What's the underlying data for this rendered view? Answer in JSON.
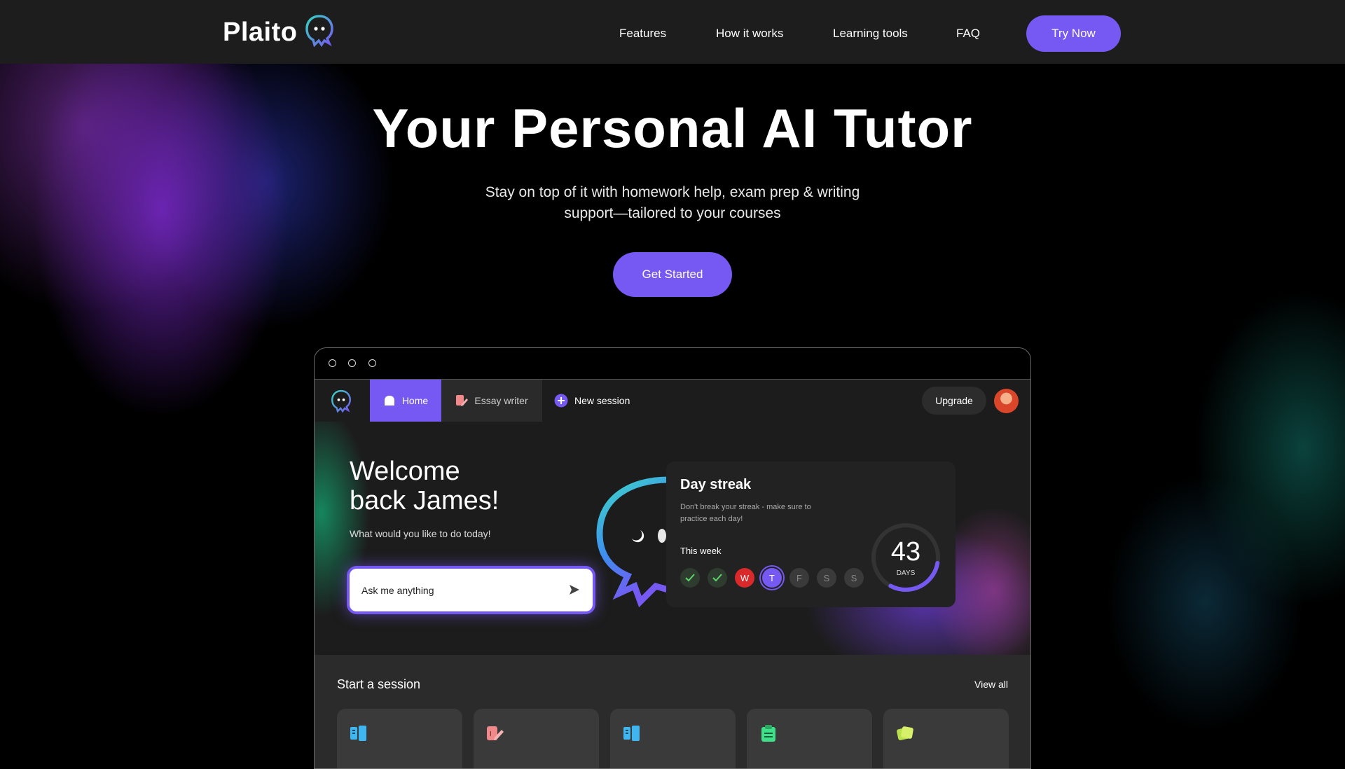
{
  "brand": {
    "name": "Plaito"
  },
  "nav": {
    "links": [
      "Features",
      "How it works",
      "Learning tools",
      "FAQ"
    ],
    "cta": "Try Now"
  },
  "hero": {
    "title": "Your Personal AI Tutor",
    "subtitle_line1": "Stay on top of it with homework help, exam prep & writing",
    "subtitle_line2": "support—tailored to your courses",
    "cta": "Get Started"
  },
  "app": {
    "tabs": {
      "home": "Home",
      "essay": "Essay writer",
      "new": "New session"
    },
    "upgrade": "Upgrade",
    "welcome": {
      "line1": "Welcome",
      "line2": "back James!",
      "subtitle": "What would you like to do today!",
      "ask_placeholder": "Ask me anything"
    },
    "streak": {
      "title": "Day streak",
      "description": "Don't break your streak - make sure to practice each day!",
      "week_label": "This week",
      "days": [
        {
          "label": "",
          "state": "done"
        },
        {
          "label": "",
          "state": "done"
        },
        {
          "label": "W",
          "state": "missed"
        },
        {
          "label": "T",
          "state": "today"
        },
        {
          "label": "F",
          "state": "future"
        },
        {
          "label": "S",
          "state": "future"
        },
        {
          "label": "S",
          "state": "future"
        }
      ],
      "count": "43",
      "unit": "DAYS",
      "progress": 0.3
    },
    "sessions": {
      "title": "Start a session",
      "view_all": "View all",
      "card_icons": [
        "book-icon",
        "essay-icon",
        "book-icon",
        "clipboard-icon",
        "flashcards-icon"
      ]
    }
  },
  "colors": {
    "accent": "#7658f2",
    "topbar": "#1d1d1d",
    "missed": "#d9292b",
    "done_check": "#5ed36b"
  }
}
